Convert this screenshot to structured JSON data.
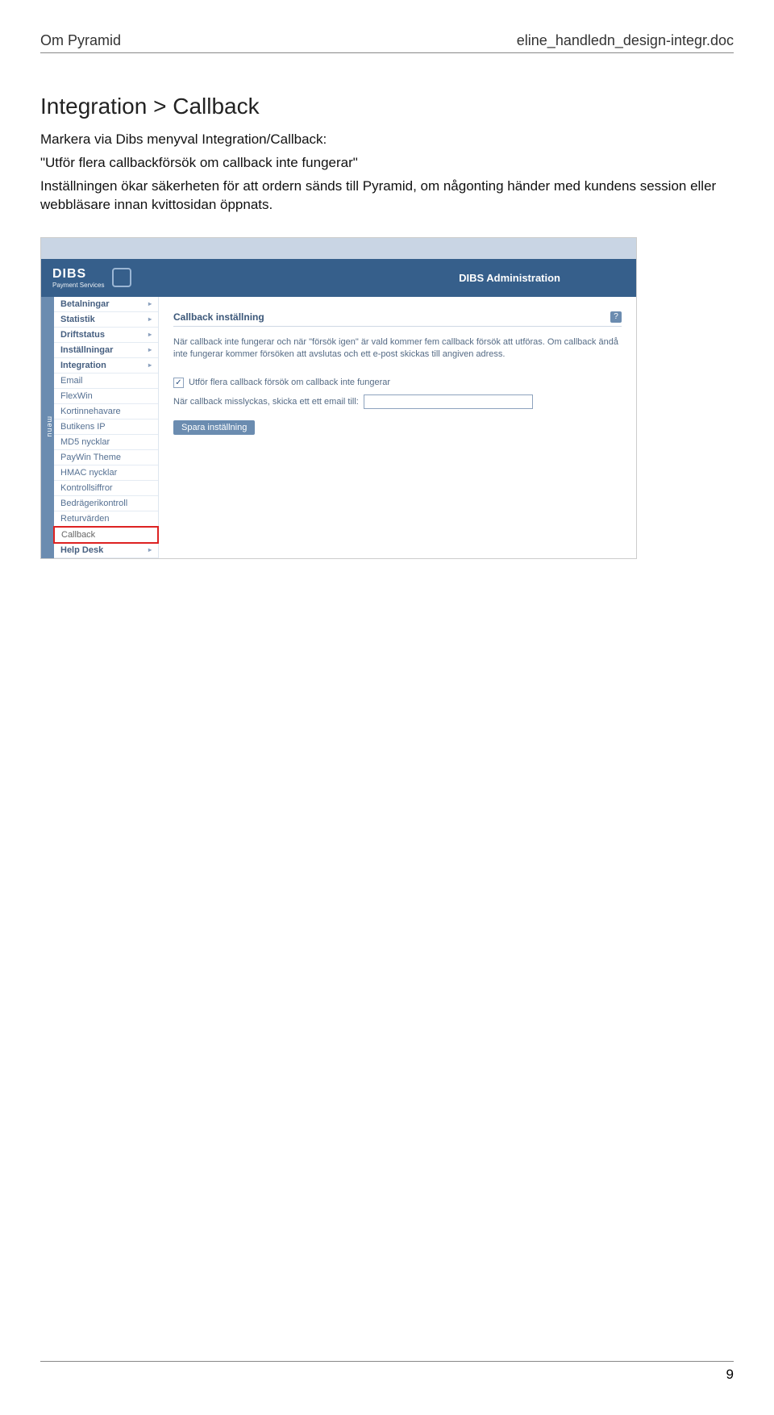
{
  "header": {
    "left": "Om Pyramid",
    "right": "eline_handledn_design-integr.doc"
  },
  "section": {
    "title": "Integration > Callback",
    "line1": "Markera via Dibs menyval Integration/Callback:",
    "line2": "\"Utför flera callbackförsök om callback inte fungerar\"",
    "line3": "Inställningen ökar säkerheten för att ordern sänds till Pyramid, om någonting händer med kundens session eller webbläsare innan kvittosidan öppnats."
  },
  "shot": {
    "brand_name": "DIBS",
    "brand_sub": "Payment Services",
    "brand_title": "DIBS Administration",
    "menu_tab": "menu",
    "sidebar": [
      {
        "label": "Betalningar",
        "bold": true,
        "arrow": true
      },
      {
        "label": "Statistik",
        "bold": true,
        "arrow": true
      },
      {
        "label": "Driftstatus",
        "bold": true,
        "arrow": true
      },
      {
        "label": "Inställningar",
        "bold": true,
        "arrow": true
      },
      {
        "label": "Integration",
        "bold": true,
        "arrow": true
      },
      {
        "label": "Email",
        "bold": false,
        "arrow": false
      },
      {
        "label": "FlexWin",
        "bold": false,
        "arrow": false
      },
      {
        "label": "Kortinnehavare",
        "bold": false,
        "arrow": false
      },
      {
        "label": "Butikens IP",
        "bold": false,
        "arrow": false
      },
      {
        "label": "MD5 nycklar",
        "bold": false,
        "arrow": false
      },
      {
        "label": "PayWin Theme",
        "bold": false,
        "arrow": false
      },
      {
        "label": "HMAC nycklar",
        "bold": false,
        "arrow": false
      },
      {
        "label": "Kontrollsiffror",
        "bold": false,
        "arrow": false
      },
      {
        "label": "Bedrägerikontroll",
        "bold": false,
        "arrow": false
      },
      {
        "label": "Returvärden",
        "bold": false,
        "arrow": false
      },
      {
        "label": "Callback",
        "bold": false,
        "arrow": false,
        "highlight": true
      },
      {
        "label": "Help Desk",
        "bold": true,
        "arrow": true
      }
    ],
    "content": {
      "heading": "Callback inställning",
      "help": "?",
      "desc": "När callback inte fungerar och när \"försök igen\" är vald kommer fem callback försök att utföras. Om callback ändå inte fungerar kommer försöken att avslutas och ett e-post skickas till angiven adress.",
      "checkbox_label": "Utför flera callback försök om callback inte fungerar",
      "checkbox_checked": "✓",
      "email_label": "När callback misslyckas, skicka ett ett email till:",
      "save_label": "Spara inställning"
    }
  },
  "footer": {
    "page": "9"
  }
}
